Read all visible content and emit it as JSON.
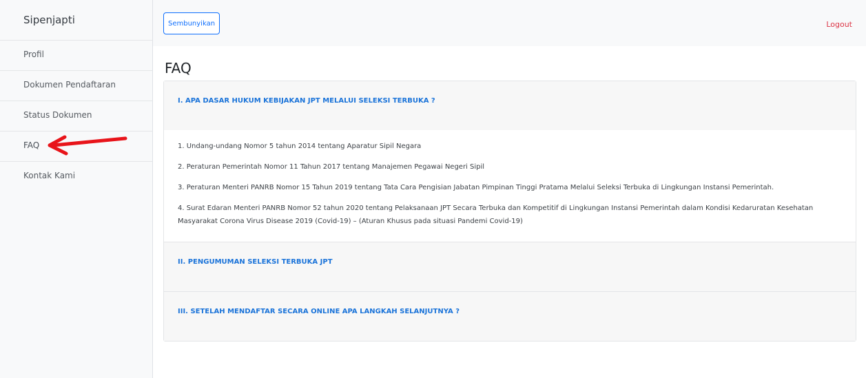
{
  "sidebar": {
    "brand": "Sipenjapti",
    "items": [
      {
        "label": "Profil"
      },
      {
        "label": "Dokumen Pendaftaran"
      },
      {
        "label": "Status Dokumen"
      },
      {
        "label": "FAQ"
      },
      {
        "label": "Kontak Kami"
      }
    ],
    "active_item": "FAQ"
  },
  "topbar": {
    "toggle_label": "Sembunyikan",
    "logout_label": "Logout"
  },
  "main": {
    "title": "FAQ",
    "faq": [
      {
        "question": "I. APA DASAR HUKUM KEBIJAKAN JPT MELALUI SELEKSI TERBUKA ?",
        "expanded": true,
        "answers": [
          "1. Undang-undang Nomor 5 tahun 2014 tentang Aparatur Sipil Negara",
          "2. Peraturan Pemerintah Nomor 11 Tahun 2017 tentang Manajemen Pegawai Negeri Sipil",
          "3. Peraturan Menteri PANRB Nomor 15 Tahun 2019 tentang Tata Cara Pengisian Jabatan Pimpinan Tinggi Pratama Melalui Seleksi Terbuka di Lingkungan Instansi Pemerintah.",
          "4. Surat Edaran Menteri PANRB Nomor 52 tahun 2020 tentang Pelaksanaan JPT Secara Terbuka dan Kompetitif di Lingkungan Instansi Pemerintah dalam Kondisi Kedaruratan Kesehatan Masyarakat Corona Virus Disease 2019 (Covid-19) – (Aturan Khusus pada situasi Pandemi Covid-19)"
        ]
      },
      {
        "question": "II. PENGUMUMAN SELEKSI TERBUKA JPT",
        "expanded": false
      },
      {
        "question": "III. SETELAH MENDAFTAR SECARA ONLINE APA LANGKAH SELANJUTNYA ?",
        "expanded": false
      }
    ]
  },
  "colors": {
    "accent": "#0d6efd",
    "question_text": "#1a73d9",
    "logout": "#dc3545",
    "annotation_arrow": "#e8141a",
    "sidebar_bg": "#f8f9fa"
  },
  "icons": {
    "annotation": "red-arrow-icon"
  }
}
